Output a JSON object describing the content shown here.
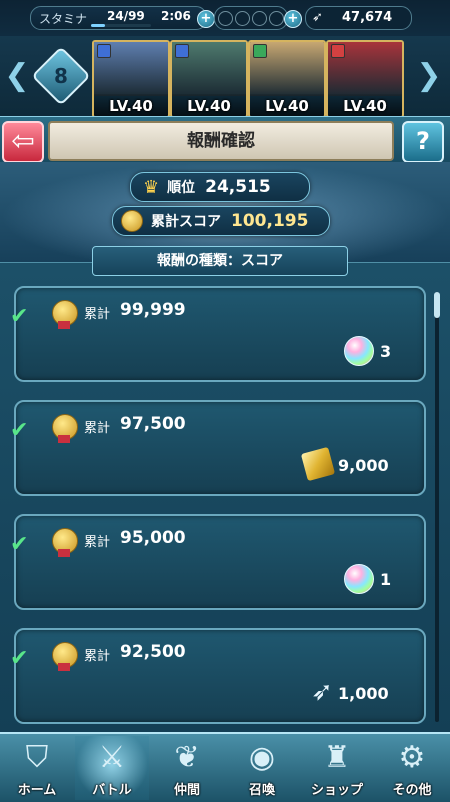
{
  "status": {
    "stamina_label": "スタミナ",
    "stamina_value": "24/99",
    "stamina_fraction": 0.24,
    "stamina_timer": "2:06",
    "feather_count": "47,674"
  },
  "team": {
    "number": "8",
    "heroes": [
      {
        "level": "LV.40",
        "weapon_color": "#3f6fd6",
        "portrait": "#5f7fb0"
      },
      {
        "level": "LV.40",
        "weapon_color": "#3f6fd6",
        "portrait": "#4e7a6e"
      },
      {
        "level": "LV.40",
        "weapon_color": "#3aa85b",
        "portrait": "#c7a772"
      },
      {
        "level": "LV.40",
        "weapon_color": "#d34141",
        "portrait": "#a8343b"
      }
    ]
  },
  "header": {
    "title": "報酬確認"
  },
  "summary": {
    "rank_label": "順位",
    "rank_value": "24,515",
    "score_label": "累計スコア",
    "score_value": "100,195"
  },
  "reward_tab": {
    "label": "報酬の種類：スコア"
  },
  "rewards": [
    {
      "label": "累計",
      "threshold": "99,999",
      "item": "orb",
      "quantity": "3"
    },
    {
      "label": "累計",
      "threshold": "97,500",
      "item": "gold",
      "quantity": "9,000"
    },
    {
      "label": "累計",
      "threshold": "95,000",
      "item": "orb",
      "quantity": "1"
    },
    {
      "label": "累計",
      "threshold": "92,500",
      "item": "feather",
      "quantity": "1,000"
    }
  ],
  "nav": {
    "items": [
      {
        "label": "ホーム",
        "icon": "home-crest-icon"
      },
      {
        "label": "バトル",
        "icon": "crossed-swords-icon"
      },
      {
        "label": "仲間",
        "icon": "wing-icon"
      },
      {
        "label": "召喚",
        "icon": "orb-icon"
      },
      {
        "label": "ショップ",
        "icon": "castle-icon"
      },
      {
        "label": "その他",
        "icon": "gear-icon"
      }
    ],
    "active_index": 1
  }
}
